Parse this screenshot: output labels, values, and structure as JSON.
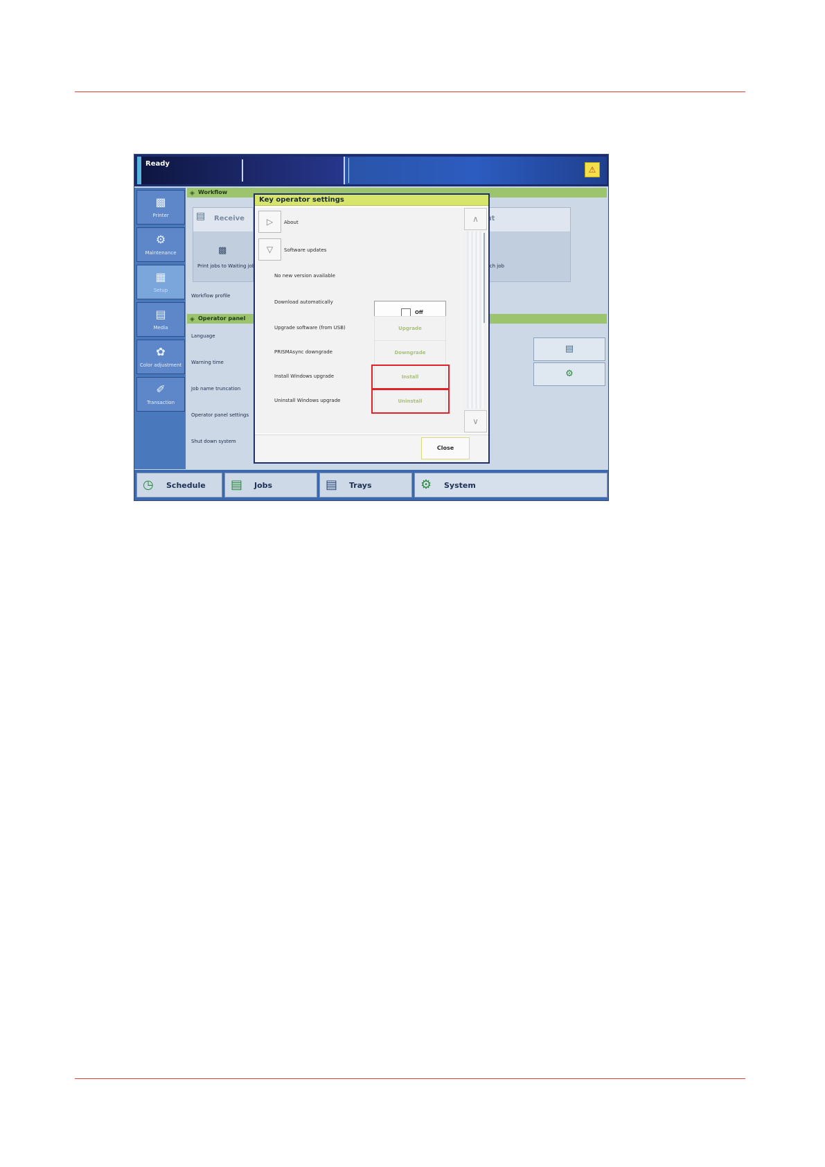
{
  "header": {
    "status": "Ready",
    "alert_icon": "alert-icon"
  },
  "sidebar": {
    "items": [
      {
        "label": "Printer",
        "icon": "printer-icon"
      },
      {
        "label": "Maintenance",
        "icon": "maintenance-icon"
      },
      {
        "label": "Setup",
        "icon": "setup-icon",
        "active": true
      },
      {
        "label": "Media",
        "icon": "media-icon"
      },
      {
        "label": "Color adjustment",
        "icon": "color-adjustment-icon"
      },
      {
        "label": "Transaction",
        "icon": "transaction-icon"
      }
    ]
  },
  "background": {
    "workflow": {
      "title": "Workflow",
      "receive": "Receive",
      "output": "Output",
      "print_jobs": "Print jobs to Waiting job",
      "after_each": "y after each job",
      "workflow_profile": "Workflow profile"
    },
    "operator_panel": {
      "title": "Operator panel",
      "language": "Language",
      "warning_time": "Warning time",
      "job_name_truncation": "Job name truncation",
      "operator_panel_settings": "Operator panel settings",
      "shut_down_system": "Shut down system"
    }
  },
  "dialog": {
    "title": "Key operator settings",
    "about": "About",
    "software_updates": "Software updates",
    "no_new_version": "No new version available",
    "download_automatically": "Download automatically",
    "download_toggle": "Off",
    "upgrade_usb": "Upgrade software (from USB)",
    "upgrade_button": "Upgrade",
    "prismasync_downgrade": "PRISMAsync downgrade",
    "downgrade_button": "Downgrade",
    "install_windows_upgrade": "Install Windows upgrade",
    "install_button": "Install",
    "uninstall_windows_upgrade": "Uninstall Windows upgrade",
    "uninstall_button": "Uninstall",
    "close_button": "Close"
  },
  "tabs": [
    {
      "label": "Schedule",
      "icon": "schedule-icon"
    },
    {
      "label": "Jobs",
      "icon": "jobs-icon"
    },
    {
      "label": "Trays",
      "icon": "trays-icon"
    },
    {
      "label": "System",
      "icon": "system-icon",
      "active": true
    }
  ],
  "colors": {
    "accent_rule": "#e03a3a",
    "highlight": "#e0232a",
    "title_bar": "#d7e56b"
  }
}
